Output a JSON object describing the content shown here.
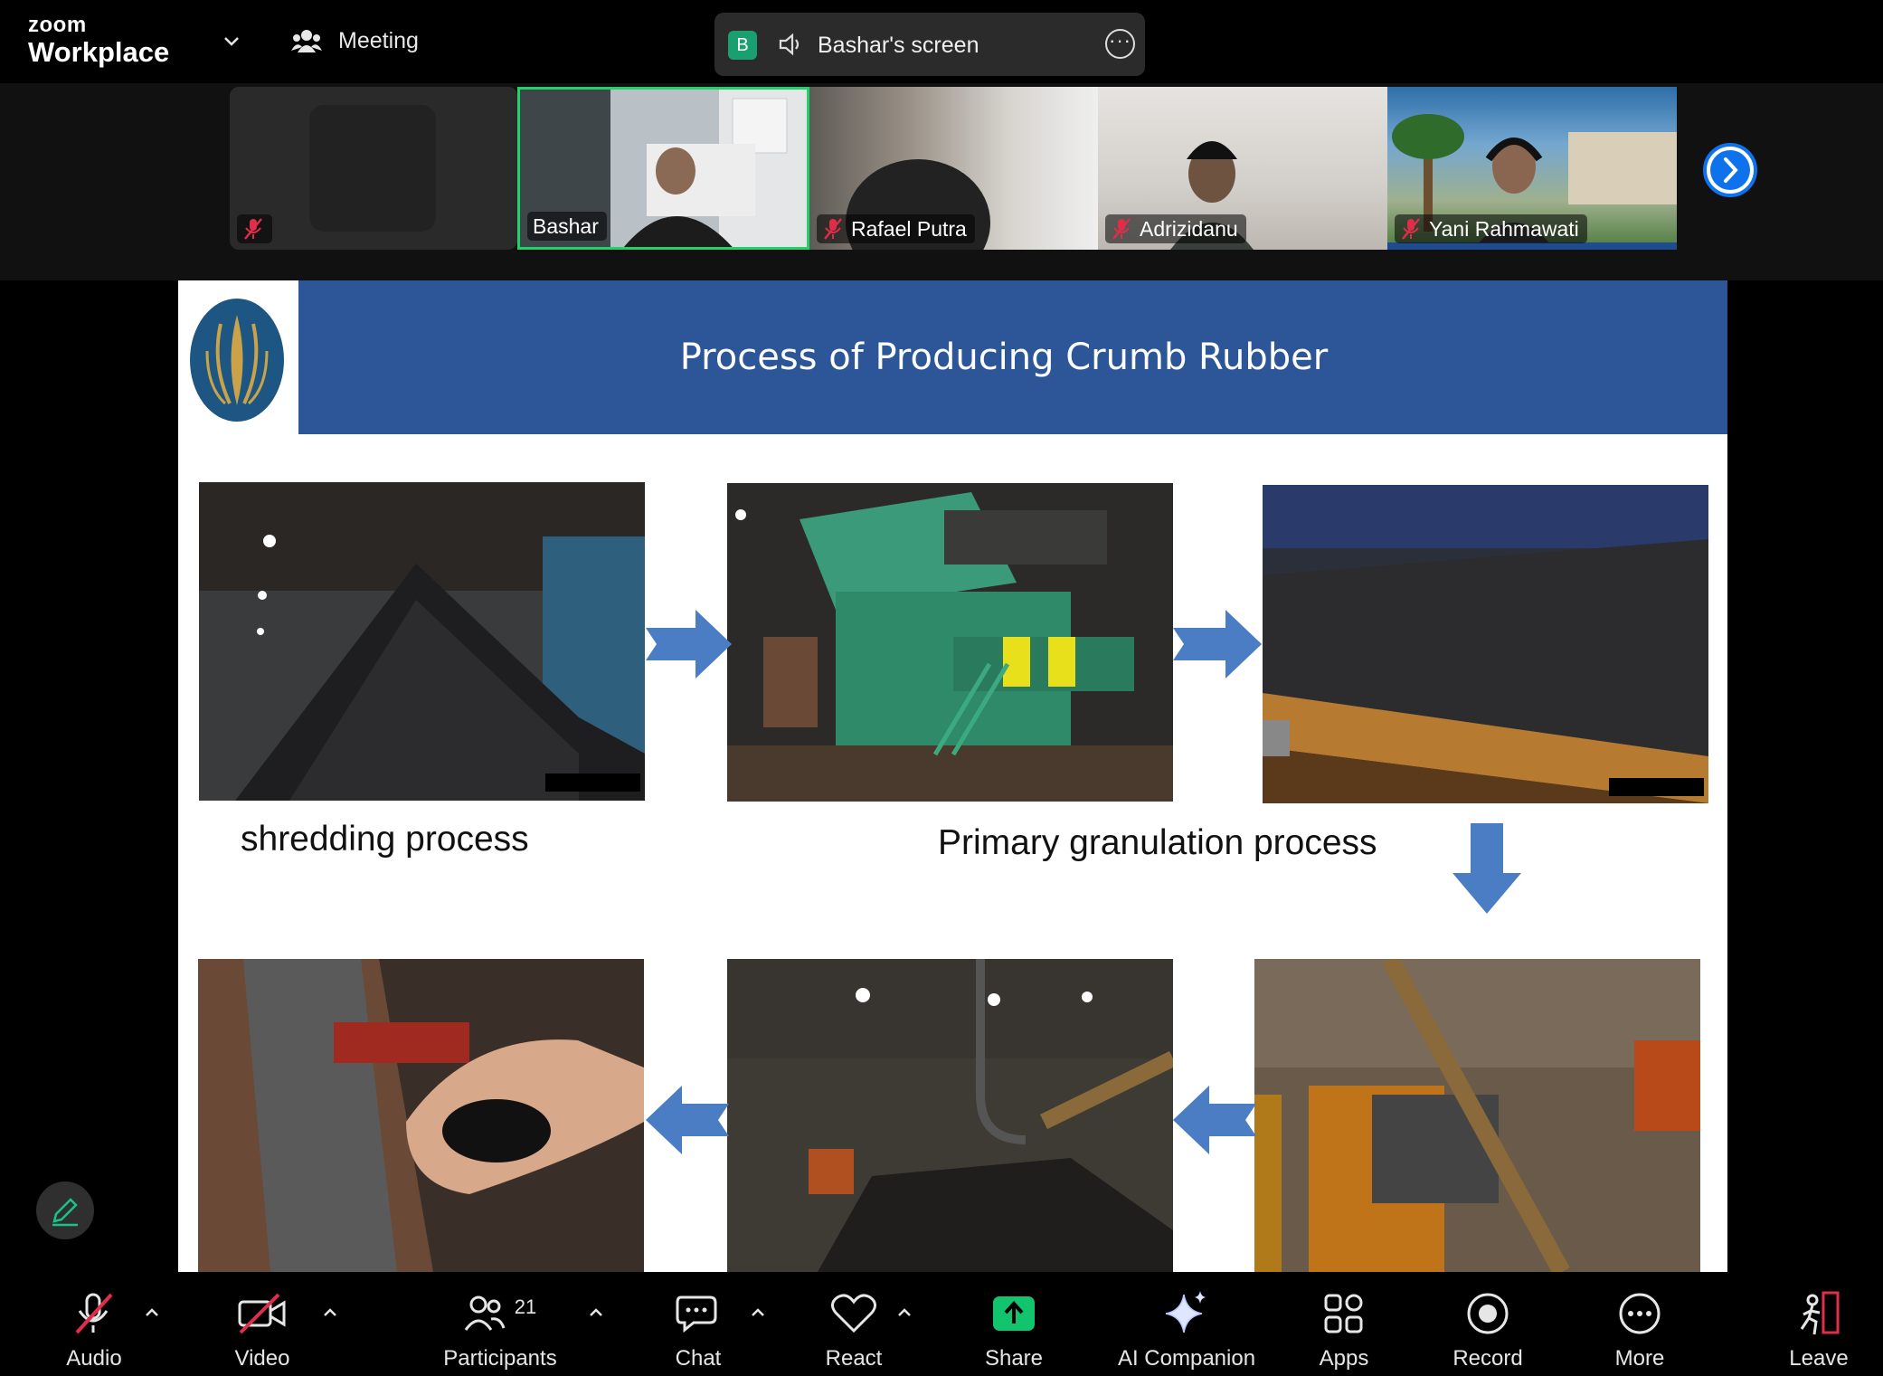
{
  "app": {
    "logo_top": "zoom",
    "logo_bottom": "Workplace",
    "meeting_label": "Meeting"
  },
  "share_pill": {
    "avatar_letter": "B",
    "label": "Bashar's screen"
  },
  "participants_strip": [
    {
      "name": "",
      "muted": true,
      "video": false
    },
    {
      "name": "Bashar",
      "muted": false,
      "active_speaker": true
    },
    {
      "name": "Rafael Putra",
      "muted": true
    },
    {
      "name": "Adrizidanu",
      "muted": true
    },
    {
      "name": "Yani Rahmawati",
      "muted": true
    }
  ],
  "slide": {
    "title": "Process of Producing Crumb Rubber",
    "caption_shredding": "shredding process",
    "caption_granulation": "Primary granulation process",
    "header_color": "#2c5698",
    "arrow_color": "#4a7dc4"
  },
  "toolbar": {
    "audio": "Audio",
    "video": "Video",
    "participants": "Participants",
    "participants_count": "21",
    "chat": "Chat",
    "react": "React",
    "share": "Share",
    "ai_companion": "AI Companion",
    "apps": "Apps",
    "record": "Record",
    "more": "More",
    "leave": "Leave"
  },
  "colors": {
    "accent_green": "#23d16b",
    "share_green": "#12c46e",
    "brand_blue": "#0e72ed",
    "muted_red": "#e02d4a"
  }
}
